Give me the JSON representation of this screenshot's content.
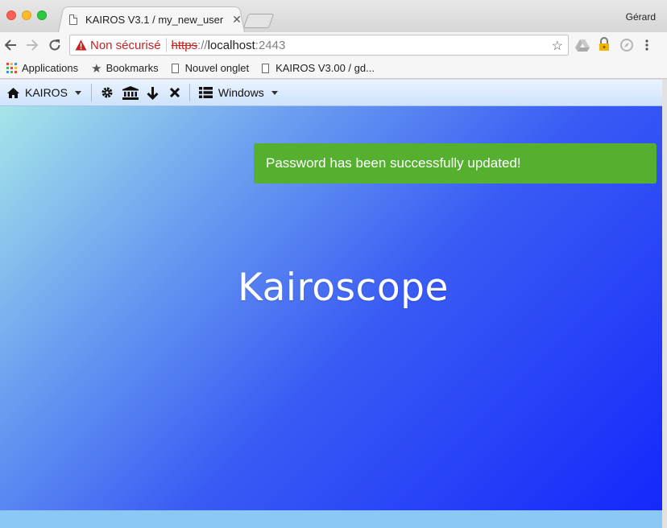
{
  "browser": {
    "tab_title": "KAIROS V3.1 / my_new_user",
    "tab_close": "✕",
    "profile_name": "Gérard",
    "security_label": "Non sécurisé",
    "url_scheme": "https",
    "url_sep": "://",
    "url_host": "localhost",
    "url_port": ":2443"
  },
  "bookmarks": [
    {
      "label": "Applications",
      "icon": "apps-icon"
    },
    {
      "label": "Bookmarks",
      "icon": "star-icon"
    },
    {
      "label": "Nouvel onglet",
      "icon": "page-icon"
    },
    {
      "label": "KAIROS V3.00 / gd...",
      "icon": "page-icon"
    }
  ],
  "appbar": {
    "home_label": "KAIROS",
    "windows_label": "Windows"
  },
  "notification": {
    "message": "Password has been successfully updated!",
    "color": "#56b02f"
  },
  "content": {
    "brand": "Kairoscope"
  },
  "colors": {
    "gradient_start": "#a6e6ea",
    "gradient_end": "#1428fb",
    "insecure": "#c5221f"
  }
}
